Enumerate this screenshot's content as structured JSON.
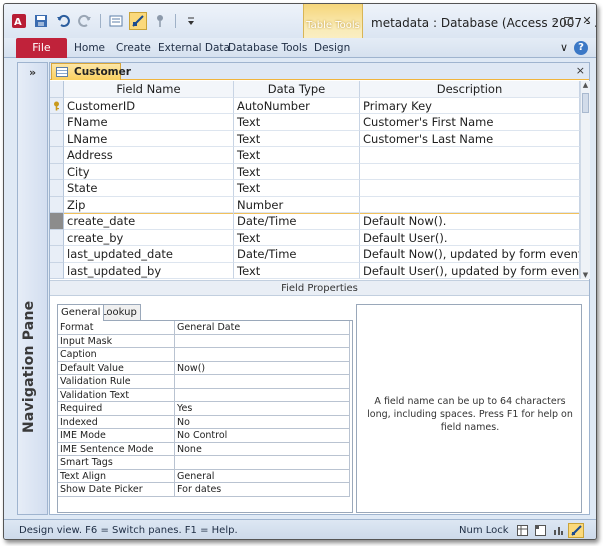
{
  "window": {
    "title": "metadata : Database (Access 2007 - ..."
  },
  "contextual_tab": {
    "label": "Table Tools"
  },
  "ribbon": {
    "file": "File",
    "tabs": [
      "Home",
      "Create",
      "External Data",
      "Database Tools",
      "Design"
    ]
  },
  "nav_pane": {
    "label": "Navigation Pane",
    "toggle": "»"
  },
  "document": {
    "tab_label": "Customer",
    "close": "×"
  },
  "design_grid": {
    "headers": [
      "Field Name",
      "Data Type",
      "Description"
    ],
    "rows": [
      {
        "field": "CustomerID",
        "type": "AutoNumber",
        "desc": "Primary Key",
        "primary_key": true
      },
      {
        "field": "FName",
        "type": "Text",
        "desc": "Customer's First Name"
      },
      {
        "field": "LName",
        "type": "Text",
        "desc": "Customer's Last Name"
      },
      {
        "field": "Address",
        "type": "Text",
        "desc": ""
      },
      {
        "field": "City",
        "type": "Text",
        "desc": ""
      },
      {
        "field": "State",
        "type": "Text",
        "desc": ""
      },
      {
        "field": "Zip",
        "type": "Number",
        "desc": ""
      },
      {
        "field": "create_date",
        "type": "Date/Time",
        "desc": "Default Now().",
        "selected": true
      },
      {
        "field": "create_by",
        "type": "Text",
        "desc": "Default User()."
      },
      {
        "field": "last_updated_date",
        "type": "Date/Time",
        "desc": "Default Now(), updated by form event."
      },
      {
        "field": "last_updated_by",
        "type": "Text",
        "desc": "Default User(), updated by form event."
      }
    ]
  },
  "field_properties": {
    "section_label": "Field Properties",
    "tabs": [
      "General",
      "Lookup"
    ],
    "active_tab": "General",
    "rows": [
      {
        "name": "Format",
        "value": "General Date"
      },
      {
        "name": "Input Mask",
        "value": ""
      },
      {
        "name": "Caption",
        "value": ""
      },
      {
        "name": "Default Value",
        "value": "Now()"
      },
      {
        "name": "Validation Rule",
        "value": ""
      },
      {
        "name": "Validation Text",
        "value": ""
      },
      {
        "name": "Required",
        "value": "Yes"
      },
      {
        "name": "Indexed",
        "value": "No"
      },
      {
        "name": "IME Mode",
        "value": "No Control"
      },
      {
        "name": "IME Sentence Mode",
        "value": "None"
      },
      {
        "name": "Smart Tags",
        "value": ""
      },
      {
        "name": "Text Align",
        "value": "General"
      },
      {
        "name": "Show Date Picker",
        "value": "For dates"
      }
    ],
    "help_text": "A field name can be up to 64 characters long, including spaces. Press F1 for help on field names."
  },
  "status_bar": {
    "text": "Design view.  F6 = Switch panes.  F1 = Help.",
    "num_lock": "Num Lock"
  },
  "colors": {
    "file_tab": "#c0223a",
    "selection": "#f9cf5e",
    "accent": "#3b78c6"
  }
}
